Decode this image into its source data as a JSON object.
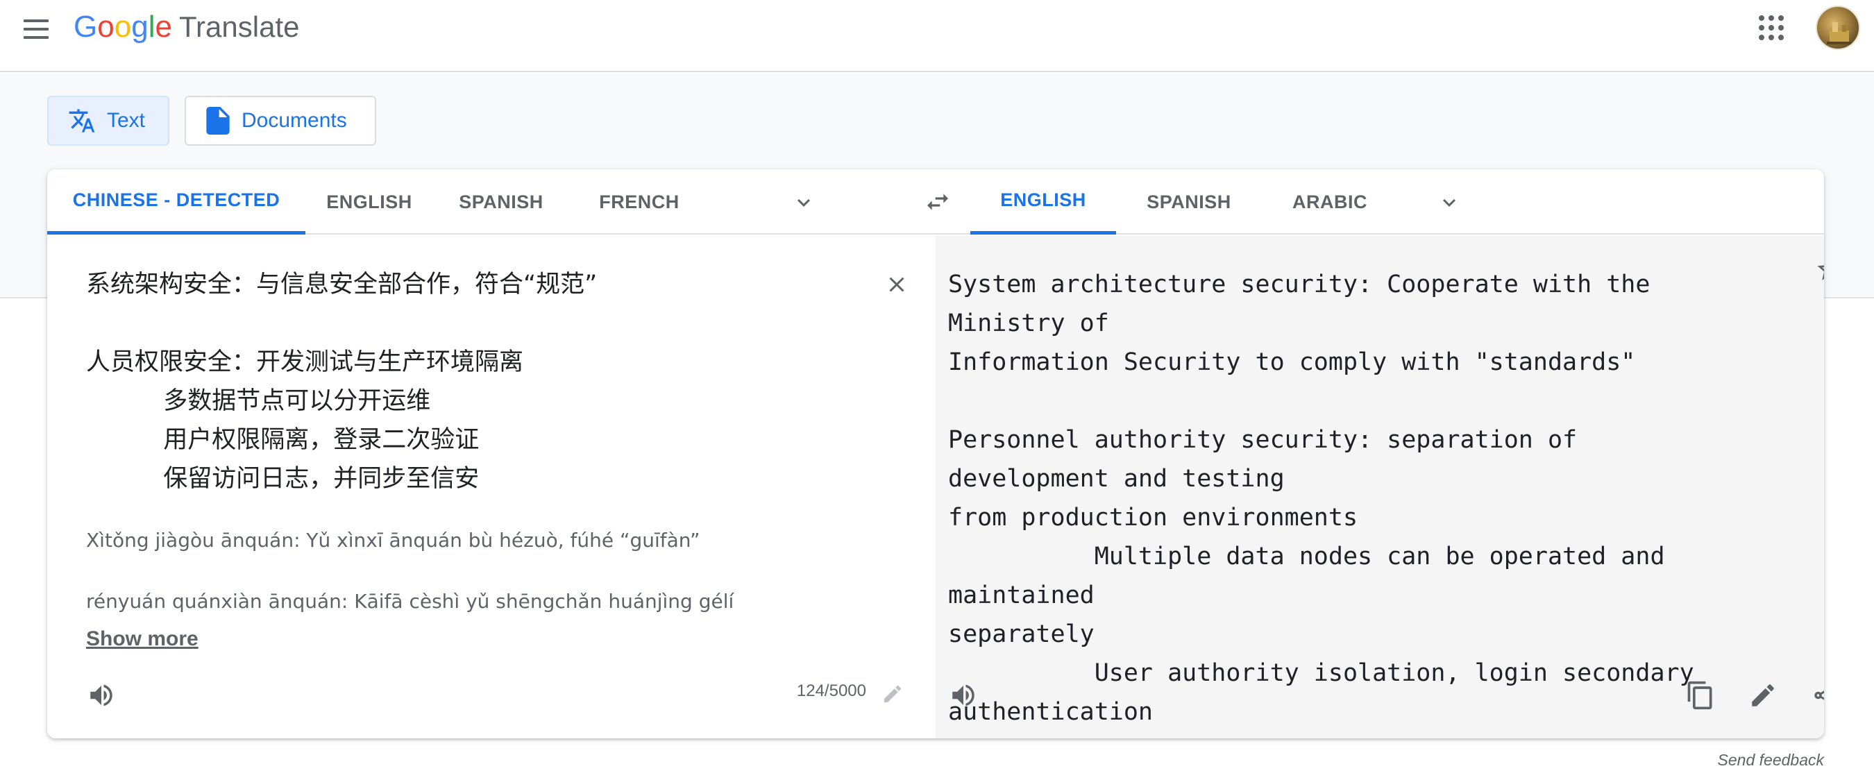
{
  "header": {
    "menu_icon": "hamburger-menu-icon",
    "logo": {
      "letters": [
        "G",
        "o",
        "o",
        "g",
        "l",
        "e"
      ],
      "colors": [
        "#4285f4",
        "#ea4335",
        "#fbbc05",
        "#4285f4",
        "#34a853",
        "#ea4335"
      ],
      "product": "Translate"
    },
    "apps_icon": "apps-grid-icon",
    "avatar_icon": "account-avatar"
  },
  "modes": {
    "text_label": "Text",
    "documents_label": "Documents",
    "text_icon": "translate-icon",
    "documents_icon": "document-icon",
    "active": "Text"
  },
  "source_languages": {
    "tabs": [
      "CHINESE - DETECTED",
      "ENGLISH",
      "SPANISH",
      "FRENCH"
    ],
    "active_index": 0,
    "more_icon": "chevron-down-icon"
  },
  "swap_icon": "swap-languages-icon",
  "target_languages": {
    "tabs": [
      "ENGLISH",
      "SPANISH",
      "ARABIC"
    ],
    "active_index": 0,
    "more_icon": "chevron-down-icon"
  },
  "source": {
    "text": "系统架构安全：与信息安全部合作，符合“规范”\n\n人员权限安全：开发测试与生产环境隔离\n          多数据节点可以分开运维\n          用户权限隔离，登录二次验证\n          保留访问日志，并同步至信安",
    "transliteration": [
      "Xìtǒng jiàgòu ānquán: Yǔ xìnxī ānquán bù hézuò, fúhé “guīfàn”",
      "rényuán quánxiàn ānquán: Kāifā cèshì yǔ shēngchǎn huánjìng gélí"
    ],
    "show_more": "Show more",
    "char_count": "124/5000",
    "clear_icon": "close-icon",
    "listen_icon": "speaker-icon",
    "edit_icon": "pencil-icon"
  },
  "target": {
    "text": "System architecture security: Cooperate with the Ministry of\nInformation Security to comply with \"standards\"\n\nPersonnel authority security: separation of development and testing\nfrom production environments\n          Multiple data nodes can be operated and maintained\nseparately\n          User authority isolation, login secondary authentication\n          Keep access logs and synchronize to Principal",
    "star_icon": "star-icon",
    "listen_icon": "speaker-icon",
    "copy_icon": "copy-icon",
    "edit_icon": "pencil-icon",
    "share_icon": "share-icon"
  },
  "footer": {
    "feedback": "Send feedback"
  },
  "colors": {
    "accent": "#1a73e8",
    "active_mode_bg": "#e8f0fe",
    "band_bg": "#f8f9fa",
    "target_bg": "#f5f5f5",
    "muted_text": "#5f6368"
  }
}
